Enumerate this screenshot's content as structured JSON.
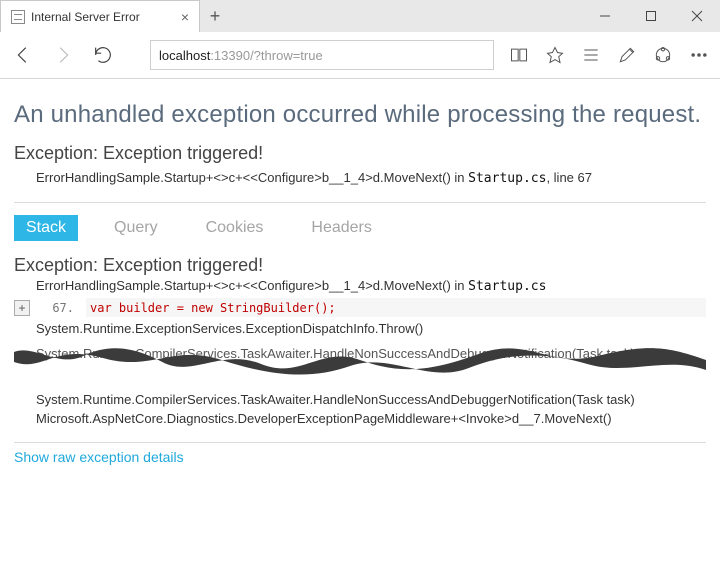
{
  "browser": {
    "tab_title": "Internal Server Error",
    "url_host": "localhost",
    "url_rest": ":13390/?throw=true"
  },
  "page": {
    "title": "An unhandled exception occurred while processing the request.",
    "exception_header": "Exception: Exception triggered!",
    "summary_stack": "ErrorHandlingSample.Startup+<>c+<<Configure>b__1_4>d.MoveNext() in ",
    "summary_file": "Startup.cs",
    "summary_line_label": ", line 67",
    "tabs": {
      "stack": "Stack",
      "query": "Query",
      "cookies": "Cookies",
      "headers": "Headers"
    },
    "stack": {
      "header": "Exception: Exception triggered!",
      "frame0": "ErrorHandlingSample.Startup+<>c+<<Configure>b__1_4>d.MoveNext() in ",
      "frame0_file": "Startup.cs",
      "line_no": "67.",
      "code": "var builder = new StringBuilder();",
      "frame1": "System.Runtime.ExceptionServices.ExceptionDispatchInfo.Throw()",
      "frame_torn": "System.Runtime.CompilerServices.TaskAwaiter.HandleNonSuccessAndDebuggerNotification(Task task)",
      "frame2": "System.Runtime.CompilerServices.TaskAwaiter.HandleNonSuccessAndDebuggerNotification(Task task)",
      "frame3": "Microsoft.AspNetCore.Diagnostics.DeveloperExceptionPageMiddleware+<Invoke>d__7.MoveNext()"
    },
    "raw_link": "Show raw exception details"
  }
}
